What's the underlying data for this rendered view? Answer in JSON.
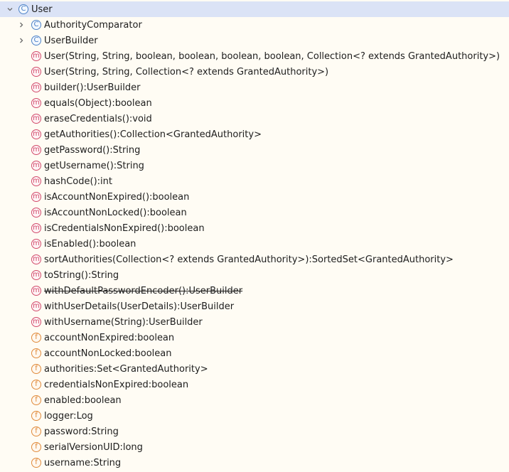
{
  "tree": {
    "root": {
      "label": "User",
      "icon": "class-icon",
      "expanded": true
    },
    "nested_classes": [
      {
        "label": "AuthorityComparator",
        "icon": "class-icon",
        "expanded": false
      },
      {
        "label": "UserBuilder",
        "icon": "class-icon",
        "expanded": false
      }
    ],
    "methods": [
      {
        "label": "User(String, String, boolean, boolean, boolean, boolean, Collection<? extends GrantedAuthority>)",
        "icon": "method-icon"
      },
      {
        "label": "User(String, String, Collection<? extends GrantedAuthority>)",
        "icon": "method-icon"
      },
      {
        "label": "builder():UserBuilder",
        "icon": "method-icon"
      },
      {
        "label": "equals(Object):boolean",
        "icon": "method-icon"
      },
      {
        "label": "eraseCredentials():void",
        "icon": "method-icon"
      },
      {
        "label": "getAuthorities():Collection<GrantedAuthority>",
        "icon": "method-icon"
      },
      {
        "label": "getPassword():String",
        "icon": "method-icon"
      },
      {
        "label": "getUsername():String",
        "icon": "method-icon"
      },
      {
        "label": "hashCode():int",
        "icon": "method-icon"
      },
      {
        "label": "isAccountNonExpired():boolean",
        "icon": "method-icon"
      },
      {
        "label": "isAccountNonLocked():boolean",
        "icon": "method-icon"
      },
      {
        "label": "isCredentialsNonExpired():boolean",
        "icon": "method-icon"
      },
      {
        "label": "isEnabled():boolean",
        "icon": "method-icon"
      },
      {
        "label": "sortAuthorities(Collection<? extends GrantedAuthority>):SortedSet<GrantedAuthority>",
        "icon": "method-icon"
      },
      {
        "label": "toString():String",
        "icon": "method-icon"
      },
      {
        "label": "withDefaultPasswordEncoder():UserBuilder",
        "icon": "method-icon",
        "deprecated": true
      },
      {
        "label": "withUserDetails(UserDetails):UserBuilder",
        "icon": "method-icon"
      },
      {
        "label": "withUsername(String):UserBuilder",
        "icon": "method-icon"
      }
    ],
    "fields": [
      {
        "label": "accountNonExpired:boolean",
        "icon": "field-icon"
      },
      {
        "label": "accountNonLocked:boolean",
        "icon": "field-icon"
      },
      {
        "label": "authorities:Set<GrantedAuthority>",
        "icon": "field-icon"
      },
      {
        "label": "credentialsNonExpired:boolean",
        "icon": "field-icon"
      },
      {
        "label": "enabled:boolean",
        "icon": "field-icon"
      },
      {
        "label": "logger:Log",
        "icon": "field-icon"
      },
      {
        "label": "password:String",
        "icon": "field-icon"
      },
      {
        "label": "serialVersionUID:long",
        "icon": "field-icon"
      },
      {
        "label": "username:String",
        "icon": "field-icon"
      }
    ],
    "icon_glyphs": {
      "class": "C",
      "method": "m",
      "field": "f"
    },
    "colors": {
      "class": "#4d82c7",
      "method": "#d24b6a",
      "field": "#e08a3a",
      "selection": "#dbe3f6"
    }
  }
}
